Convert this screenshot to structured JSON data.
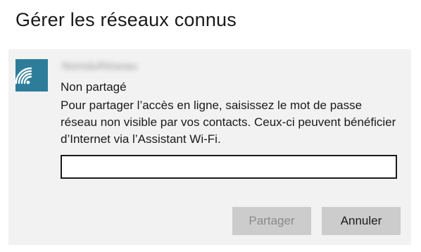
{
  "dialog": {
    "title": "Gérer les réseaux connus"
  },
  "network": {
    "icon": "wifi-icon",
    "name_blurred": "NomduRéseau",
    "status": "Non partagé",
    "description": "Pour partager l’accès en ligne, saisissez le mot de passe réseau non visible par vos contacts. Ceux-ci peuvent bénéficier d’Internet via l’Assistant Wi-Fi.",
    "password_value": ""
  },
  "actions": {
    "share_label": "Partager",
    "cancel_label": "Annuler"
  },
  "colors": {
    "accent": "#2d7d9a",
    "panel_bg": "#f2f2f2",
    "button_bg": "#cccccc"
  }
}
